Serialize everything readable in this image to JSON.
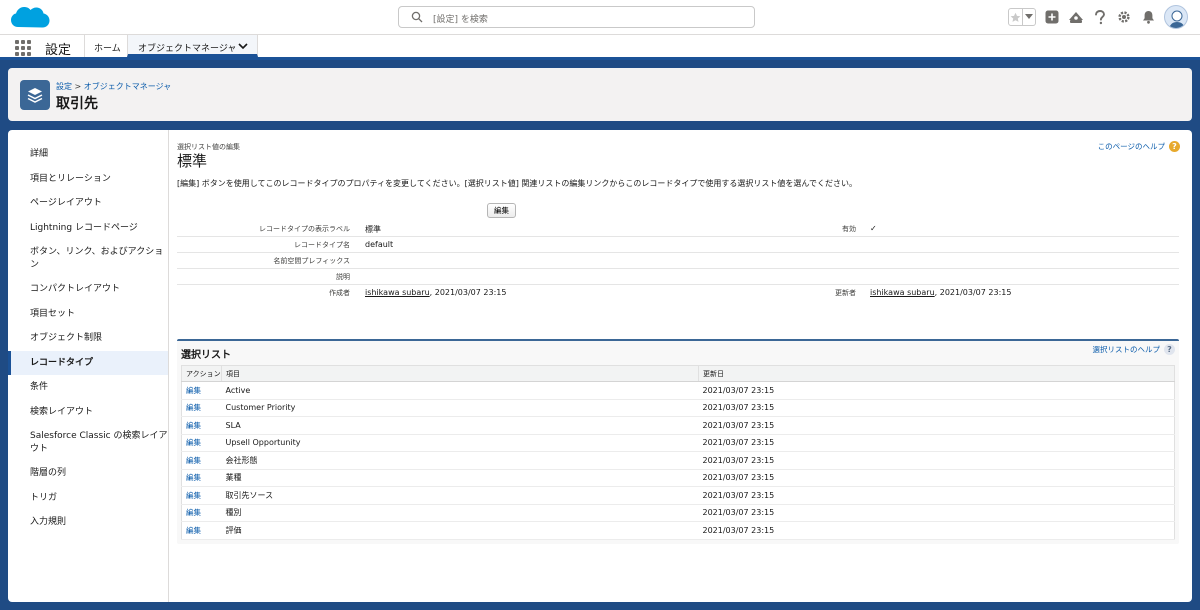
{
  "header": {
    "search_placeholder": "[設定] を検索"
  },
  "nav": {
    "app_name": "設定",
    "tabs": [
      {
        "label": "ホーム"
      },
      {
        "label": "オブジェクトマネージャ"
      }
    ]
  },
  "page_header": {
    "breadcrumb_setup": "設定",
    "breadcrumb_sep": " > ",
    "breadcrumb_object_manager": "オブジェクトマネージャ",
    "title": "取引先"
  },
  "sidebar": {
    "items": [
      {
        "label": "詳細"
      },
      {
        "label": "項目とリレーション"
      },
      {
        "label": "ページレイアウト"
      },
      {
        "label": "Lightning レコードページ"
      },
      {
        "label": "ボタン、リンク、およびアクション"
      },
      {
        "label": "コンパクトレイアウト"
      },
      {
        "label": "項目セット"
      },
      {
        "label": "オブジェクト制限"
      },
      {
        "label": "レコードタイプ"
      },
      {
        "label": "条件"
      },
      {
        "label": "検索レイアウト"
      },
      {
        "label": "Salesforce Classic の検索レイアウト"
      },
      {
        "label": "階層の列"
      },
      {
        "label": "トリガ"
      },
      {
        "label": "入力規則"
      }
    ],
    "active_index": 8
  },
  "content": {
    "breadcrumb": "選択リスト値の編集",
    "record_type_name": "標準",
    "help_link": "このページのヘルプ",
    "instruction": "[編集] ボタンを使用してこのレコードタイプのプロパティを変更してください。[選択リスト値] 関連リストの編集リンクからこのレコードタイプで使用する選択リスト値を選んでください。",
    "edit_button": "編集",
    "details": {
      "label_display": "レコードタイプの表示ラベル",
      "value_display": "標準",
      "label_active": "有効",
      "value_active": "✓",
      "label_name": "レコードタイプ名",
      "value_name": "default",
      "label_namespace": "名前空間プレフィックス",
      "label_description": "説明",
      "label_created_by": "作成者",
      "created_user": "ishikawa subaru",
      "created_date": ", 2021/03/07 23:15",
      "label_modified_by": "更新者",
      "modified_user": "ishikawa subaru",
      "modified_date": ", 2021/03/07 23:15"
    }
  },
  "picklists": {
    "title": "選択リスト",
    "help_link": "選択リストのヘルプ",
    "columns": {
      "action": "アクション",
      "field": "項目",
      "modified": "更新日"
    },
    "rows": [
      {
        "action": "編集",
        "field": "Active",
        "modified": "2021/03/07 23:15"
      },
      {
        "action": "編集",
        "field": "Customer Priority",
        "modified": "2021/03/07 23:15"
      },
      {
        "action": "編集",
        "field": "SLA",
        "modified": "2021/03/07 23:15"
      },
      {
        "action": "編集",
        "field": "Upsell Opportunity",
        "modified": "2021/03/07 23:15"
      },
      {
        "action": "編集",
        "field": "会社形態",
        "modified": "2021/03/07 23:15"
      },
      {
        "action": "編集",
        "field": "業種",
        "modified": "2021/03/07 23:15"
      },
      {
        "action": "編集",
        "field": "取引先ソース",
        "modified": "2021/03/07 23:15"
      },
      {
        "action": "編集",
        "field": "種別",
        "modified": "2021/03/07 23:15"
      },
      {
        "action": "編集",
        "field": "評価",
        "modified": "2021/03/07 23:15"
      }
    ]
  },
  "colors": {
    "brand": "#1b5297",
    "link": "#0b5cab",
    "cloud": "#00a1e0"
  }
}
